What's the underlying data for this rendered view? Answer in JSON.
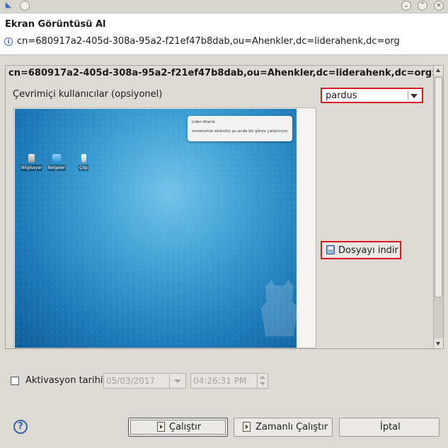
{
  "window": {
    "title": "Ekran Görüntüsü Al",
    "info_message": "cn=680917a2-405d-308a-95a2-f21ef47b8dab,ou=Ahenkler,dc=liderahenk,dc=org"
  },
  "panel": {
    "heading": "cn=680917a2-405d-308a-95a2-f21ef47b8dab,ou=Ahenkler,dc=liderahenk,dc=org:",
    "online_users_label": "Çevrimiçi kullanıcılar (opsiyonel)",
    "online_users_selected": "pardus",
    "download_button_label": "Dosyayı indir"
  },
  "preview": {
    "notification_title": "Lider Ahenk",
    "notification_body": "screenshot eklentisi şu anda bir görev çalıştırıyor.",
    "desktop_icons": [
      {
        "label": "Bilgisayar",
        "icon": "computer-icon"
      },
      {
        "label": "Belgeler",
        "icon": "folder-icon"
      },
      {
        "label": "Çöp",
        "icon": "trash-icon"
      }
    ]
  },
  "activation": {
    "label": "Aktivasyon tarihi",
    "date_value": "05/03/2017",
    "time_value": "04:26:31 PM"
  },
  "buttons": {
    "run": "Çalıştır",
    "scheduled_run": "Zamanlı Çalıştır",
    "cancel": "İptal"
  },
  "colors": {
    "highlight_border": "#d9191d",
    "desktop_blue": "#1d7ab8"
  }
}
